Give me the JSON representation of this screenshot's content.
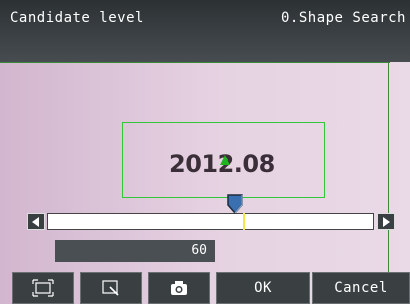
{
  "header": {
    "left_title": "Candidate level",
    "right_title": "0.Shape Search"
  },
  "image": {
    "roi_text": "2012.08"
  },
  "slider": {
    "value": 60,
    "value_text": "60"
  },
  "toolbar": {
    "icons": [
      "region-select-icon",
      "zoom-region-icon",
      "camera-icon"
    ],
    "ok_label": "OK",
    "cancel_label": "Cancel"
  },
  "colors": {
    "accent_green": "#34c63a",
    "thumb_blue": "#3a6fb0"
  }
}
